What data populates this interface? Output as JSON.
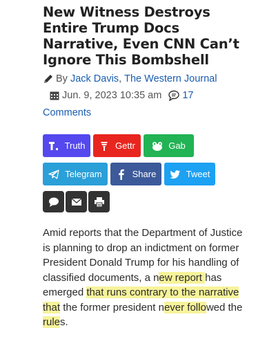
{
  "headline": "New Witness Destroys Entire Trump Docs Narrative, Even CNN Can’t Ignore This Bombshell",
  "byline": {
    "prefix": "By",
    "author": "Jack Davis",
    "separator": ",",
    "outlet": "The Western Journal"
  },
  "dateline": {
    "date": "Jun. 9, 2023 10:35 am",
    "comment_count": "17",
    "comments_label": "Comments"
  },
  "share_buttons": {
    "truth": "Truth",
    "gettr": "Gettr",
    "gab": "Gab",
    "telegram": "Telegram",
    "share": "Share",
    "tweet": "Tweet"
  },
  "colors": {
    "truth": "#5448ee",
    "gettr": "#e8261f",
    "gab": "#21b354",
    "telegram": "#2a9fd8",
    "facebook": "#3c5a99",
    "twitter": "#1da1f2",
    "icon_buttons": "#333333",
    "highlight": "#f7f39a",
    "link": "#1a5db0"
  },
  "icon_buttons": [
    "speech-bubble-icon",
    "email-icon",
    "print-icon"
  ],
  "article": {
    "seg1": "Amid reports that the Department of Justice is planning to drop an indictment on former President Donald Trump for his handling of classified documents, a n",
    "seg2": "ew report ",
    "seg3": "has emerged ",
    "seg4": "that runs contrary to the narrative that",
    "seg5": " the former president n",
    "seg6": "ever follo",
    "seg7": "wed the ",
    "seg8": "rule",
    "seg9": "s."
  }
}
